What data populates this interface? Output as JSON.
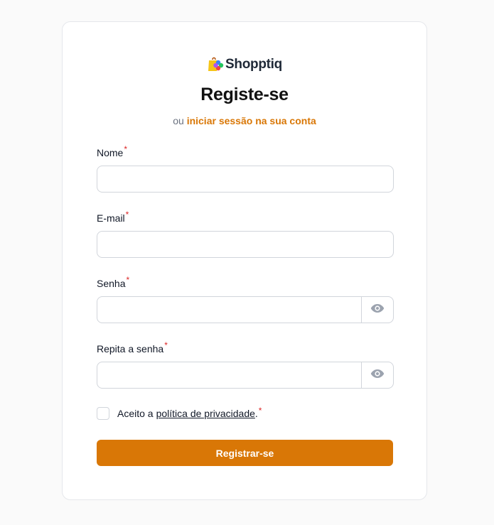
{
  "brand": {
    "name": "Shopptiq",
    "icon": "shopping-bag-logo-icon",
    "accent": "#d97706"
  },
  "form": {
    "title": "Registe-se",
    "subtitle_prefix": "ou",
    "login_link": "iniciar sessão na sua conta",
    "required_mark": "*",
    "fields": {
      "name": {
        "label": "Nome",
        "value": "",
        "placeholder": ""
      },
      "email": {
        "label": "E-mail",
        "value": "",
        "placeholder": ""
      },
      "password": {
        "label": "Senha",
        "value": "",
        "placeholder": "",
        "toggle_icon": "eye-icon"
      },
      "password_repeat": {
        "label": "Repita a senha",
        "value": "",
        "placeholder": "",
        "toggle_icon": "eye-icon"
      }
    },
    "terms": {
      "checked": false,
      "prefix": "Aceito a",
      "link": "política de privacidade",
      "suffix": "."
    },
    "submit_label": "Registrar-se"
  }
}
